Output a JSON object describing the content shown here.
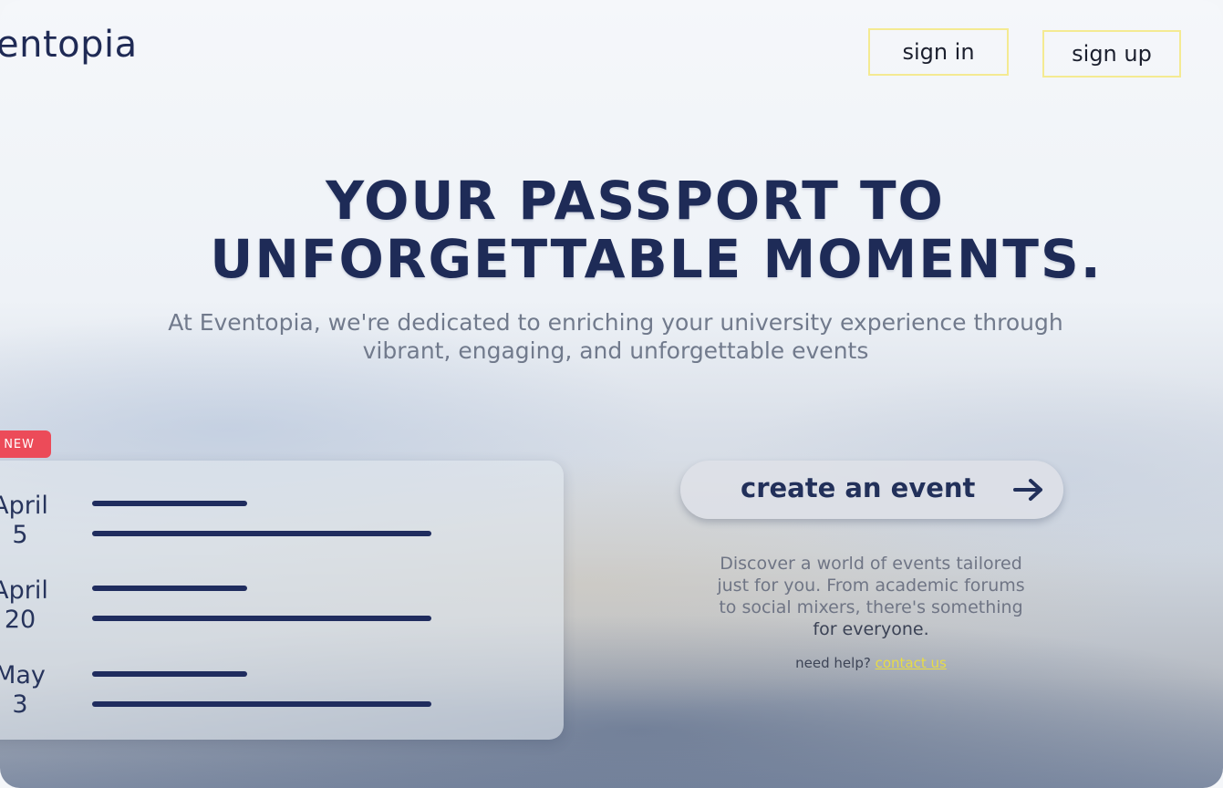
{
  "header": {
    "brand": "entopia",
    "signin_label": "sign in",
    "signup_label": "sign up",
    "button_border_color": "#f4ea92"
  },
  "hero": {
    "title_line1": "YOUR PASSPORT TO",
    "title_line2": "UNFORGETTABLE MOMENTS.",
    "subtitle_line1": "At Eventopia, we're dedicated to enriching your university experience through",
    "subtitle_line2": "vibrant, engaging, and unforgettable events",
    "title_color": "#1e2b57"
  },
  "events_card": {
    "badge": "NEW",
    "badge_color": "#ec4b59",
    "events": [
      {
        "month": "April",
        "day": "5"
      },
      {
        "month": "April",
        "day": "20"
      },
      {
        "month": "May",
        "day": "3"
      }
    ]
  },
  "cta": {
    "label": "create an event",
    "icon": "arrow-right-icon"
  },
  "description": {
    "line1": "Discover a world of events tailored",
    "line2": "just for you. From academic forums",
    "line3": "to social mixers, there's something",
    "line4": "for everyone."
  },
  "help": {
    "text": "need help?",
    "link": "contact us",
    "link_color": "#e8dc45"
  }
}
